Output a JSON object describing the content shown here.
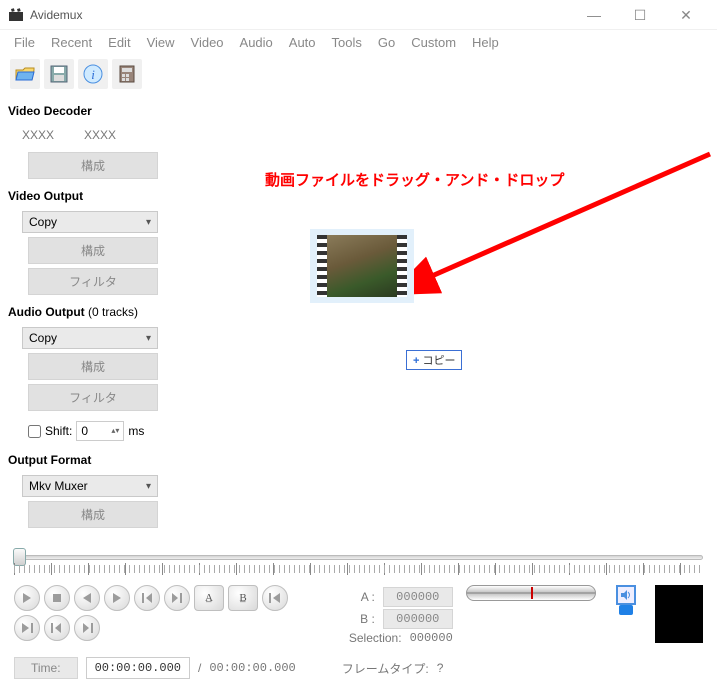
{
  "window": {
    "title": "Avidemux",
    "sys": {
      "min": "—",
      "max": "☐",
      "close": "✕"
    }
  },
  "menu": {
    "file": "File",
    "recent": "Recent",
    "edit": "Edit",
    "view": "View",
    "video": "Video",
    "audio": "Audio",
    "auto": "Auto",
    "tools": "Tools",
    "go": "Go",
    "custom": "Custom",
    "help": "Help"
  },
  "sidebar": {
    "video_decoder_label": "Video Decoder",
    "decoder_a": "XXXX",
    "decoder_b": "XXXX",
    "configure": "構成",
    "video_output_label": "Video Output",
    "video_output_value": "Copy",
    "filter": "フィルタ",
    "audio_output_label": "Audio Output",
    "audio_tracks_suffix": "(0 tracks)",
    "audio_output_value": "Copy",
    "shift_label": "Shift:",
    "shift_value": "0",
    "shift_unit": "ms",
    "output_format_label": "Output Format",
    "output_format_value": "Mkv Muxer"
  },
  "preview": {
    "annotation": "動画ファイルをドラッグ・アンド・ドロップ",
    "copy_badge": "コピー"
  },
  "selection": {
    "a_label": "A :",
    "a_value": "000000",
    "b_label": "B :",
    "b_value": "000000",
    "sel_label": "Selection:",
    "sel_value": "000000"
  },
  "footer": {
    "time_label": "Time:",
    "time_current": "00:00:00.000",
    "time_sep": "/",
    "time_total": "00:00:00.000",
    "frametype_label": "フレームタイプ:",
    "frametype_value": "?"
  }
}
